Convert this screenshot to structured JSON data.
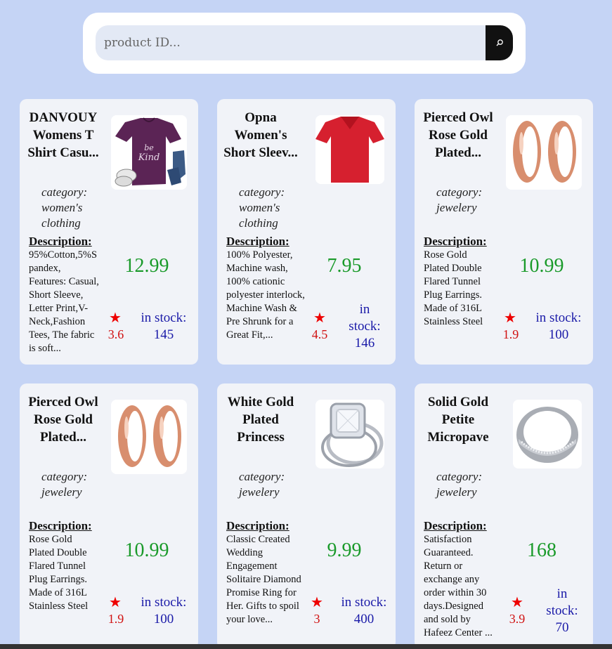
{
  "search": {
    "placeholder": "product ID...",
    "icon": "search-icon"
  },
  "labels": {
    "description": "Description:",
    "in_stock_prefix": "in stock:"
  },
  "colors": {
    "price": "#1a9a2a",
    "rating": "#d01010",
    "stock": "#1a1aa8",
    "background": "#c5d4f5"
  },
  "products": [
    {
      "title": "DANVOUY Womens T Shirt Casu...",
      "category": "category: women's clothing",
      "description": "95%Cotton,5%Spandex, Features: Casual, Short Sleeve, Letter Print,V-Neck,Fashion Tees, The fabric is soft...",
      "price": "12.99",
      "rating": "3.6",
      "stock": "in stock: 145",
      "image": "purple-tshirt"
    },
    {
      "title": "Opna Women's Short Sleev...",
      "category": "category: women's clothing",
      "description": "100% Polyester, Machine wash, 100% cationic polyester interlock, Machine Wash & Pre Shrunk for a Great Fit,...",
      "price": "7.95",
      "rating": "4.5",
      "stock": "in stock: 146",
      "image": "red-tshirt"
    },
    {
      "title": "Pierced Owl Rose Gold Plated...",
      "category": "category: jewelery",
      "description": "Rose Gold Plated Double Flared Tunnel Plug Earrings. Made of 316L Stainless Steel",
      "price": "10.99",
      "rating": "1.9",
      "stock": "in stock: 100",
      "image": "rose-gold-plugs"
    },
    {
      "title": "Pierced Owl Rose Gold Plated...",
      "category": "category: jewelery",
      "description": "Rose Gold Plated Double Flared Tunnel Plug Earrings. Made of 316L Stainless Steel",
      "price": "10.99",
      "rating": "1.9",
      "stock": "in stock: 100",
      "image": "rose-gold-plugs"
    },
    {
      "title": "White Gold Plated Princess",
      "category": "category: jewelery",
      "description": "Classic Created Wedding Engagement Solitaire Diamond Promise Ring for Her. Gifts to spoil your love...",
      "price": "9.99",
      "rating": "3",
      "stock": "in stock: 400",
      "image": "diamond-ring"
    },
    {
      "title": "Solid Gold Petite Micropave",
      "category": "category: jewelery",
      "description": "Satisfaction Guaranteed. Return or exchange any order within 30 days.Designed and sold by Hafeez Center ...",
      "price": "168",
      "rating": "3.9",
      "stock": "in stock: 70",
      "image": "silver-band-ring"
    }
  ]
}
